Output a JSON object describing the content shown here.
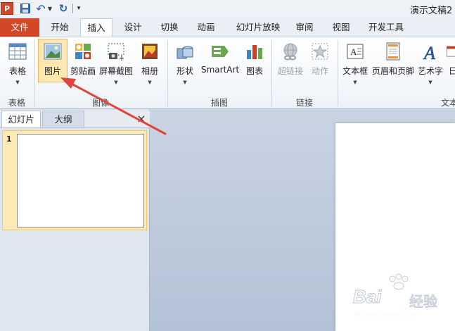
{
  "titlebar": {
    "app_logo": "P",
    "doc_title": "演示文稿2 -",
    "qa_customize": "▾",
    "undo_drop": "▼"
  },
  "tabs": [
    "文件",
    "开始",
    "插入",
    "设计",
    "切换",
    "动画",
    "幻灯片放映",
    "审阅",
    "视图",
    "开发工具"
  ],
  "active_tab": "插入",
  "ribbon": {
    "groups": {
      "table": "表格",
      "images": "图像",
      "illustrations": "插图",
      "links": "链接",
      "text": "文本"
    },
    "buttons": {
      "table": "表格",
      "picture": "图片",
      "clipart": "剪贴画",
      "screenshot": "屏幕截图",
      "album": "相册",
      "shapes": "形状",
      "smartart": "SmartArt",
      "chart": "图表",
      "hyperlink": "超链接",
      "action": "动作",
      "textbox": "文本框",
      "header_footer": "页眉和页脚",
      "wordart": "艺术字",
      "date": "日"
    },
    "dropdown_glyph": "▼"
  },
  "left_panel": {
    "tab_slides": "幻灯片",
    "tab_outline": "大纲",
    "close": "×",
    "slide_number": "1"
  },
  "watermark": {
    "brand": "Bai",
    "brand2": "经验",
    "url": "jingyan.baidu.com"
  },
  "colors": {
    "file_tab": "#d24726",
    "accent_blue": "#2c5ea8",
    "arrow": "#e0443b",
    "thumb_highlight": "#fce9b6"
  }
}
